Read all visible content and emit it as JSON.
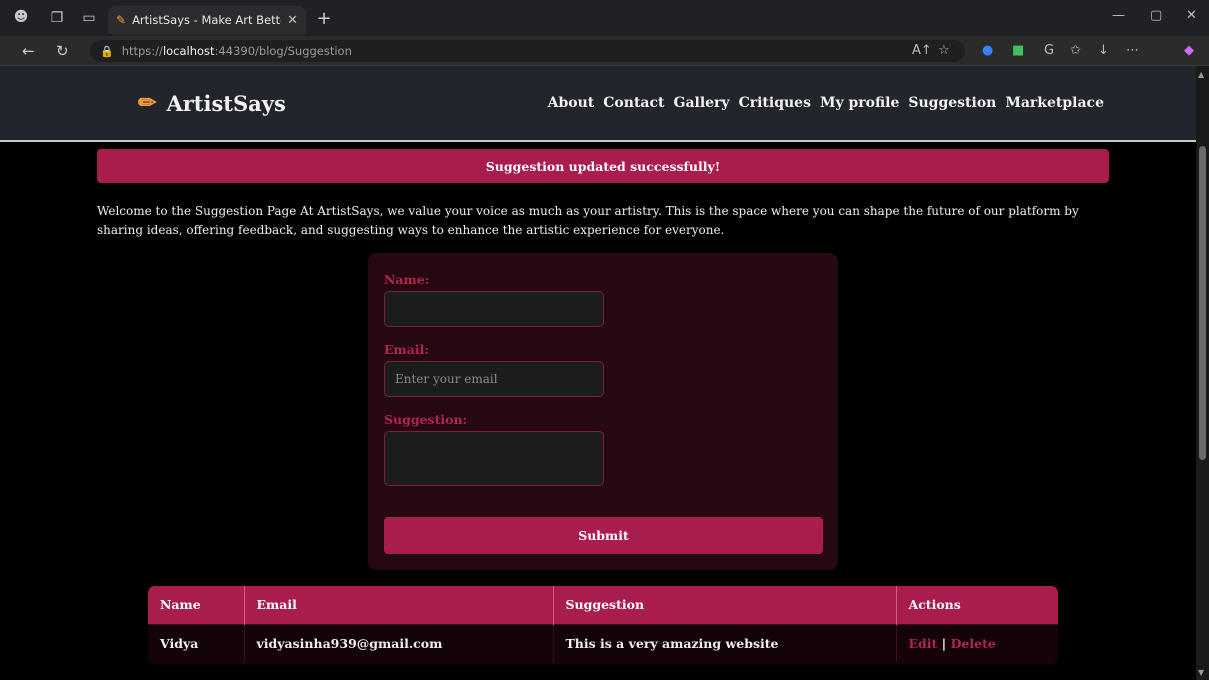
{
  "browser": {
    "tab_title": "ArtistSays - Make Art Better",
    "url_prefix": "https://",
    "url_host": "localhost",
    "url_rest": ":44390/blog/Suggestion"
  },
  "site": {
    "brand": "ArtistSays",
    "nav": [
      "About",
      "Contact",
      "Gallery",
      "Critiques",
      "My profile",
      "Suggestion",
      "Marketplace"
    ]
  },
  "alert": "Suggestion updated successfully!",
  "intro": "Welcome to the Suggestion Page At ArtistSays, we value your voice as much as your artistry. This is the space where you can shape the future of our platform by sharing ideas, offering feedback, and suggesting ways to enhance the artistic experience for everyone.",
  "form": {
    "name_label": "Name:",
    "name_value": "",
    "email_label": "Email:",
    "email_placeholder": "Enter your email",
    "suggestion_label": "Suggestion:",
    "suggestion_value": "",
    "submit_label": "Submit"
  },
  "table": {
    "headers": [
      "Name",
      "Email",
      "Suggestion",
      "Actions"
    ],
    "rows": [
      {
        "name": "Vidya",
        "email": "vidyasinha939@gmail.com",
        "suggestion": "This is a very amazing website",
        "edit": "Edit",
        "sep": "|",
        "delete": "Delete"
      }
    ]
  },
  "colors": {
    "accent": "#a81d4e",
    "label": "#b3244f",
    "card": "#250811",
    "header": "#22252b"
  }
}
